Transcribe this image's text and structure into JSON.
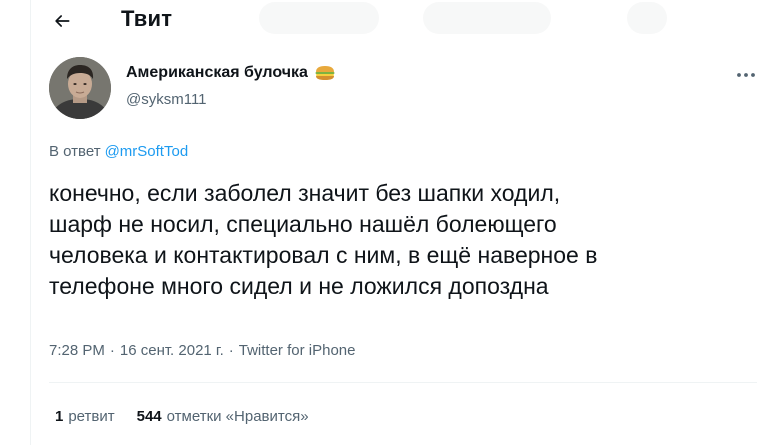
{
  "header": {
    "title": "Твит",
    "back_icon": "arrow-left-icon"
  },
  "tweet": {
    "author": {
      "display_name": "Американская булочка",
      "emoji_icon": "sandwich-emoji-icon",
      "handle": "@syksm111",
      "avatar": "avatar"
    },
    "more_icon": "more-dots-icon",
    "reply_to": {
      "prefix": "В ответ",
      "mention": "@mrSoftTod"
    },
    "text_lines": [
      "конечно, если заболел значит без шапки ходил,",
      "шарф не носил, специально нашёл болеющего",
      "человека и контактировал с ним, в ещё наверное в",
      "телефоне много сидел и не ложился допоздна"
    ],
    "time": "7:28 PM",
    "separator": "·",
    "date": "16 сент. 2021 г.",
    "source": "Twitter for iPhone"
  },
  "stats": {
    "retweets_count": "1",
    "retweets_label": "ретвит",
    "likes_count": "544",
    "likes_label": "отметки «Нравится»"
  },
  "colors": {
    "text": "#0f1419",
    "secondary": "#536471",
    "accent": "#1d9bf0",
    "divider": "#eff3f4"
  }
}
